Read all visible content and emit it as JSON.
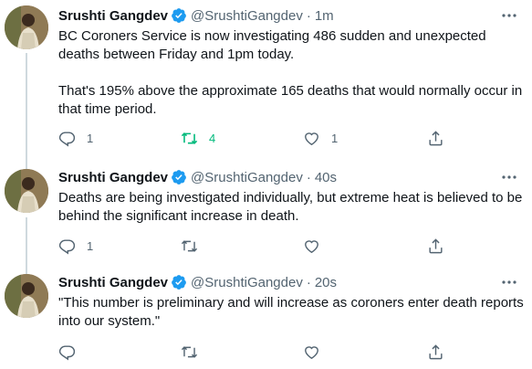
{
  "colors": {
    "verified": "#1d9bf0",
    "retweet_active": "#00ba7c",
    "text_secondary": "#536471",
    "thread_line": "#cfd9de"
  },
  "tweets": [
    {
      "name": "Srushti Gangdev",
      "handle": "@SrushtiGangdev",
      "separator": "·",
      "time": "1m",
      "paragraphs": [
        "BC Coroners Service is now investigating 486 sudden and unexpected deaths between Friday and 1pm today.",
        "That's 195% above the approximate 165 deaths that would normally occur in that time period."
      ],
      "reply_count": "1",
      "retweet_count": "4",
      "retweeted": true,
      "like_count": "1"
    },
    {
      "name": "Srushti Gangdev",
      "handle": "@SrushtiGangdev",
      "separator": "·",
      "time": "40s",
      "paragraphs": [
        "Deaths are being investigated individually, but extreme heat is believed to be behind the significant increase in death."
      ],
      "reply_count": "1",
      "retweet_count": "",
      "retweeted": false,
      "like_count": ""
    },
    {
      "name": "Srushti Gangdev",
      "handle": "@SrushtiGangdev",
      "separator": "·",
      "time": "20s",
      "paragraphs": [
        "\"This number is preliminary and will increase as coroners enter death reports into our system.\""
      ],
      "reply_count": "",
      "retweet_count": "",
      "retweeted": false,
      "like_count": ""
    }
  ]
}
